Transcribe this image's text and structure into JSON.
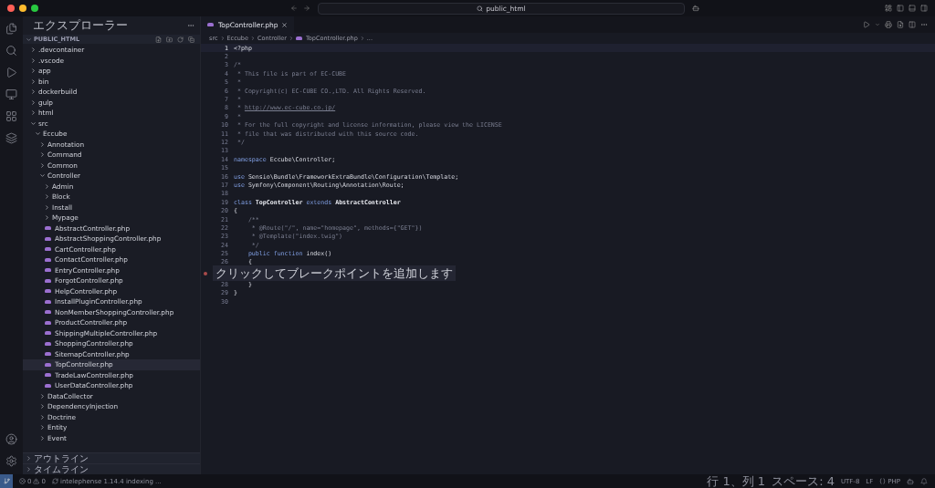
{
  "titlebar": {
    "search": "public_html"
  },
  "sidebar": {
    "title": "エクスプローラー",
    "section": "PUBLIC_HTML",
    "tree": [
      {
        "name": ".devcontainer",
        "kind": "folder",
        "expanded": false,
        "selected": false
      },
      {
        "name": ".vscode",
        "kind": "folder",
        "expanded": false,
        "selected": false
      },
      {
        "name": "app",
        "kind": "folder",
        "expanded": false,
        "selected": false
      },
      {
        "name": "bin",
        "kind": "folder",
        "expanded": false,
        "selected": false
      },
      {
        "name": "dockerbuild",
        "kind": "folder",
        "expanded": false,
        "selected": false
      },
      {
        "name": "gulp",
        "kind": "folder",
        "expanded": false,
        "selected": false
      },
      {
        "name": "html",
        "kind": "folder",
        "expanded": false,
        "selected": false
      },
      {
        "name": "src",
        "kind": "folder",
        "expanded": true,
        "selected": false,
        "children": [
          {
            "name": "Eccube",
            "kind": "folder",
            "expanded": true,
            "selected": false,
            "children": [
              {
                "name": "Annotation",
                "kind": "folder",
                "expanded": false,
                "selected": false
              },
              {
                "name": "Command",
                "kind": "folder",
                "expanded": false,
                "selected": false
              },
              {
                "name": "Common",
                "kind": "folder",
                "expanded": false,
                "selected": false
              },
              {
                "name": "Controller",
                "kind": "folder",
                "expanded": true,
                "selected": false,
                "children": [
                  {
                    "name": "Admin",
                    "kind": "folder",
                    "expanded": false,
                    "selected": false
                  },
                  {
                    "name": "Block",
                    "kind": "folder",
                    "expanded": false,
                    "selected": false
                  },
                  {
                    "name": "Install",
                    "kind": "folder",
                    "expanded": false,
                    "selected": false
                  },
                  {
                    "name": "Mypage",
                    "kind": "folder",
                    "expanded": false,
                    "selected": false
                  },
                  {
                    "name": "AbstractController.php",
                    "kind": "file",
                    "selected": false
                  },
                  {
                    "name": "AbstractShoppingController.php",
                    "kind": "file",
                    "selected": false
                  },
                  {
                    "name": "CartController.php",
                    "kind": "file",
                    "selected": false
                  },
                  {
                    "name": "ContactController.php",
                    "kind": "file",
                    "selected": false
                  },
                  {
                    "name": "EntryController.php",
                    "kind": "file",
                    "selected": false
                  },
                  {
                    "name": "ForgotController.php",
                    "kind": "file",
                    "selected": false
                  },
                  {
                    "name": "HelpController.php",
                    "kind": "file",
                    "selected": false
                  },
                  {
                    "name": "InstallPluginController.php",
                    "kind": "file",
                    "selected": false
                  },
                  {
                    "name": "NonMemberShoppingController.php",
                    "kind": "file",
                    "selected": false
                  },
                  {
                    "name": "ProductController.php",
                    "kind": "file",
                    "selected": false
                  },
                  {
                    "name": "ShippingMultipleController.php",
                    "kind": "file",
                    "selected": false
                  },
                  {
                    "name": "ShoppingController.php",
                    "kind": "file",
                    "selected": false
                  },
                  {
                    "name": "SitemapController.php",
                    "kind": "file",
                    "selected": false
                  },
                  {
                    "name": "TopController.php",
                    "kind": "file",
                    "selected": true
                  },
                  {
                    "name": "TradeLawController.php",
                    "kind": "file",
                    "selected": false
                  },
                  {
                    "name": "UserDataController.php",
                    "kind": "file",
                    "selected": false
                  }
                ]
              },
              {
                "name": "DataCollector",
                "kind": "folder",
                "expanded": false,
                "selected": false
              },
              {
                "name": "DependencyInjection",
                "kind": "folder",
                "expanded": false,
                "selected": false
              },
              {
                "name": "Doctrine",
                "kind": "folder",
                "expanded": false,
                "selected": false
              },
              {
                "name": "Entity",
                "kind": "folder",
                "expanded": false,
                "selected": false
              },
              {
                "name": "Event",
                "kind": "folder",
                "expanded": false,
                "selected": false
              }
            ]
          }
        ]
      }
    ],
    "panels": [
      {
        "label": "アウトライン",
        "expanded": false
      },
      {
        "label": "タイムライン",
        "expanded": false
      }
    ]
  },
  "editor": {
    "tabs": [
      {
        "label": "TopController.php",
        "selected": true
      }
    ],
    "breadcrumbs": [
      "src",
      "Eccube",
      "Controller",
      "TopController.php",
      "..."
    ],
    "lines": [
      {
        "kind": "code",
        "number": "1",
        "current": true,
        "segments": [
          {
            "kind": "plain",
            "text": "<?php"
          }
        ]
      },
      {
        "kind": "code",
        "number": "2",
        "current": false
      },
      {
        "kind": "code",
        "number": "3",
        "current": false,
        "segments": [
          {
            "kind": "comment",
            "text": "/*"
          }
        ]
      },
      {
        "kind": "code",
        "number": "4",
        "current": false,
        "segments": [
          {
            "kind": "comment",
            "text": " * This file is part of EC-CUBE"
          }
        ]
      },
      {
        "kind": "code",
        "number": "5",
        "current": false,
        "segments": [
          {
            "kind": "comment",
            "text": " *"
          }
        ]
      },
      {
        "kind": "code",
        "number": "6",
        "current": false,
        "segments": [
          {
            "kind": "comment",
            "text": " * Copyright(c) EC-CUBE CO.,LTD. All Rights Reserved."
          }
        ]
      },
      {
        "kind": "code",
        "number": "7",
        "current": false,
        "segments": [
          {
            "kind": "comment",
            "text": " *"
          }
        ]
      },
      {
        "kind": "code",
        "number": "8",
        "current": false,
        "segments": [
          {
            "kind": "comment",
            "text": " * "
          },
          {
            "kind": "link",
            "text": "http://www.ec-cube.co.jp/"
          }
        ]
      },
      {
        "kind": "code",
        "number": "9",
        "current": false,
        "segments": [
          {
            "kind": "comment",
            "text": " *"
          }
        ]
      },
      {
        "kind": "code",
        "number": "10",
        "current": false,
        "segments": [
          {
            "kind": "comment",
            "text": " * For the full copyright and license information, please view the LICENSE"
          }
        ]
      },
      {
        "kind": "code",
        "number": "11",
        "current": false,
        "segments": [
          {
            "kind": "comment",
            "text": " * file that was distributed with this source code."
          }
        ]
      },
      {
        "kind": "code",
        "number": "12",
        "current": false,
        "segments": [
          {
            "kind": "comment",
            "text": " */"
          }
        ]
      },
      {
        "kind": "code",
        "number": "13",
        "current": false
      },
      {
        "kind": "code",
        "number": "14",
        "current": false,
        "segments": [
          {
            "kind": "keyword",
            "text": "namespace "
          },
          {
            "kind": "plain",
            "text": "Eccube\\Controller;"
          }
        ]
      },
      {
        "kind": "code",
        "number": "15",
        "current": false
      },
      {
        "kind": "code",
        "number": "16",
        "current": false,
        "segments": [
          {
            "kind": "keyword",
            "text": "use "
          },
          {
            "kind": "plain",
            "text": "Sensio\\Bundle\\FrameworkExtraBundle\\Configuration\\Template;"
          }
        ]
      },
      {
        "kind": "code",
        "number": "17",
        "current": false,
        "segments": [
          {
            "kind": "keyword",
            "text": "use "
          },
          {
            "kind": "plain",
            "text": "Symfony\\Component\\Routing\\Annotation\\Route;"
          }
        ]
      },
      {
        "kind": "code",
        "number": "18",
        "current": false
      },
      {
        "kind": "code",
        "number": "19",
        "current": false,
        "segments": [
          {
            "kind": "keyword",
            "text": "class "
          },
          {
            "kind": "type",
            "text": "TopController "
          },
          {
            "kind": "keyword",
            "text": "extends "
          },
          {
            "kind": "type",
            "text": "AbstractController"
          }
        ]
      },
      {
        "kind": "code",
        "number": "20",
        "current": false,
        "segments": [
          {
            "kind": "plain",
            "text": "{"
          }
        ]
      },
      {
        "kind": "code",
        "number": "21",
        "current": false,
        "segments": [
          {
            "kind": "comment",
            "text": "    /**"
          }
        ]
      },
      {
        "kind": "code",
        "number": "22",
        "current": false,
        "segments": [
          {
            "kind": "comment",
            "text": "     * @Route(\"/\", name=\"homepage\", methods={\"GET\"})"
          }
        ]
      },
      {
        "kind": "code",
        "number": "23",
        "current": false,
        "segments": [
          {
            "kind": "comment",
            "text": "     * @Template(\"index.twig\")"
          }
        ]
      },
      {
        "kind": "code",
        "number": "24",
        "current": false,
        "segments": [
          {
            "kind": "comment",
            "text": "     */"
          }
        ]
      },
      {
        "kind": "code",
        "number": "25",
        "current": false,
        "segments": [
          {
            "kind": "keyword",
            "text": "    public function "
          },
          {
            "kind": "plain",
            "text": "index()"
          }
        ]
      },
      {
        "kind": "code",
        "number": "26",
        "current": false,
        "segments": [
          {
            "kind": "plain",
            "text": "    {"
          }
        ]
      },
      {
        "kind": "hint",
        "text": "クリックしてブレークポイントを追加します"
      },
      {
        "kind": "code",
        "number": "28",
        "current": false,
        "segments": [
          {
            "kind": "plain",
            "text": "    }"
          }
        ]
      },
      {
        "kind": "code",
        "number": "29",
        "current": false,
        "segments": [
          {
            "kind": "plain",
            "text": "}"
          }
        ]
      },
      {
        "kind": "code",
        "number": "30",
        "current": false
      }
    ]
  },
  "status_bar": {
    "errors": "0",
    "warnings": "0",
    "task": "intelephense 1.14.4 indexing ...",
    "position": "行 1、列 1",
    "indent": "スペース: 4",
    "encoding": "UTF-8",
    "eol": "LF",
    "language": "PHP"
  }
}
